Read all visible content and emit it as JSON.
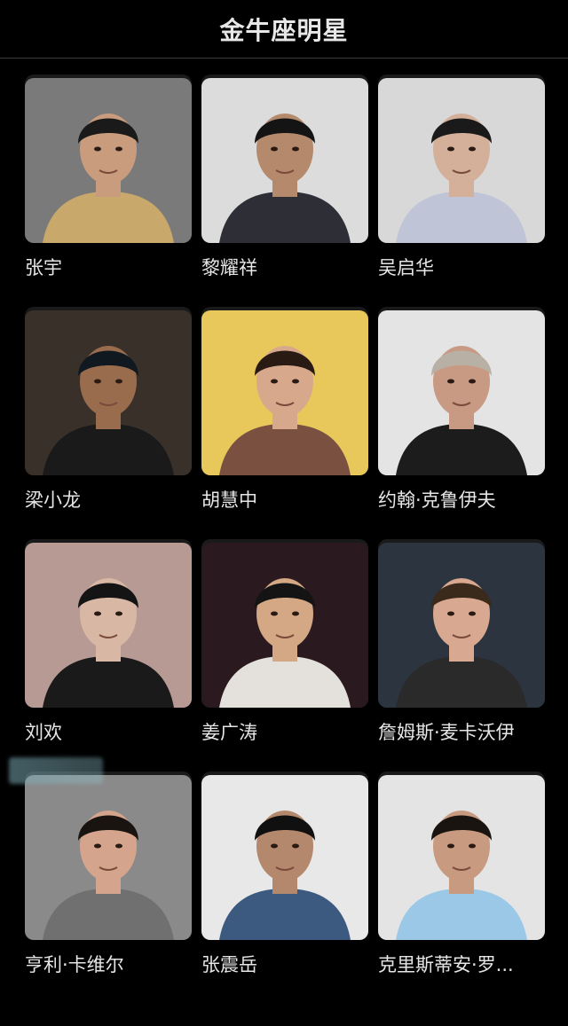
{
  "page": {
    "title": "金牛座明星"
  },
  "celebrities": [
    {
      "name": "张宇",
      "bg": "#7a7a7a",
      "shirt": "#c9a86b",
      "hair": "#1a1a1a",
      "skin": "#c89c7c"
    },
    {
      "name": "黎耀祥",
      "bg": "#dcdcdc",
      "shirt": "#2e2e36",
      "hair": "#141414",
      "skin": "#b58a6c"
    },
    {
      "name": "吴启华",
      "bg": "#d8d8d8",
      "shirt": "#bfc4d6",
      "hair": "#1a1a1a",
      "skin": "#d4b09a"
    },
    {
      "name": "梁小龙",
      "bg": "#3a302a",
      "shirt": "#1a1a1a",
      "hair": "#101820",
      "skin": "#9a6c4e"
    },
    {
      "name": "胡慧中",
      "bg": "#e8c85a",
      "shirt": "#7a5040",
      "hair": "#2a1a14",
      "skin": "#d8a88c"
    },
    {
      "name": "约翰·克鲁伊夫",
      "bg": "#e4e4e4",
      "shirt": "#1c1c1c",
      "hair": "#b8b0a4",
      "skin": "#c89a84"
    },
    {
      "name": "刘欢",
      "bg": "#b89a94",
      "shirt": "#1a1a1a",
      "hair": "#141414",
      "skin": "#d8b8a4"
    },
    {
      "name": "姜广涛",
      "bg": "#2a1a20",
      "shirt": "#e4e0dc",
      "hair": "#141414",
      "skin": "#d4a884"
    },
    {
      "name": "詹姆斯·麦卡沃伊",
      "bg": "#2c3440",
      "shirt": "#2a2a2a",
      "hair": "#3a2a1c",
      "skin": "#d8a890"
    },
    {
      "name": "亨利·卡维尔",
      "bg": "#8a8a8a",
      "shirt": "#707070",
      "hair": "#1a1410",
      "skin": "#d4a48c"
    },
    {
      "name": "张震岳",
      "bg": "#e8e8e8",
      "shirt": "#3c5a80",
      "hair": "#101010",
      "skin": "#b4886c"
    },
    {
      "name": "克里斯蒂安·罗...",
      "bg": "#e4e4e4",
      "shirt": "#9cc8e8",
      "hair": "#1a1410",
      "skin": "#c89a80"
    }
  ]
}
